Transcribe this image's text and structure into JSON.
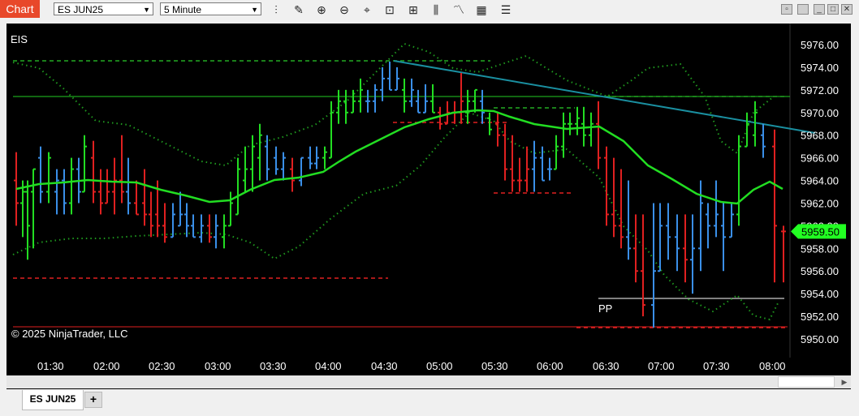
{
  "window": {
    "title": "Chart"
  },
  "toolbar": {
    "instrument": "ES JUN25",
    "interval": "5 Minute",
    "tools": [
      "bar-type-icon",
      "draw-pencil-icon",
      "zoom-in-icon",
      "zoom-out-icon",
      "crosshair-icon",
      "data-box-icon",
      "chart-trader-icon",
      "indicators-icon",
      "strategies-icon",
      "properties-icon",
      "templates-icon"
    ]
  },
  "chart": {
    "symbol_label": "EIS",
    "copyright": "© 2025 NinjaTrader, LLC",
    "pivot_label": "PP",
    "last_price": "5959.50",
    "y_ticks": [
      "5976.00",
      "5974.00",
      "5972.00",
      "5970.00",
      "5968.00",
      "5966.00",
      "5964.00",
      "5962.00",
      "5960.00",
      "5958.00",
      "5956.00",
      "5954.00",
      "5952.00",
      "5950.00"
    ],
    "x_ticks": [
      "01:30",
      "02:00",
      "02:30",
      "03:00",
      "03:30",
      "04:00",
      "04:30",
      "05:00",
      "05:30",
      "06:00",
      "06:30",
      "07:00",
      "07:30",
      "08:00"
    ],
    "colors": {
      "up": "#22dd22",
      "down": "#e02020",
      "neutral": "#3a8fe8",
      "ma": "#22dd22",
      "trend": "#1a8fa0",
      "bands": "#1f9a1f",
      "last_price_bg": "#22ff22"
    }
  },
  "tabs": {
    "active": "ES JUN25",
    "add_label": "+"
  }
}
